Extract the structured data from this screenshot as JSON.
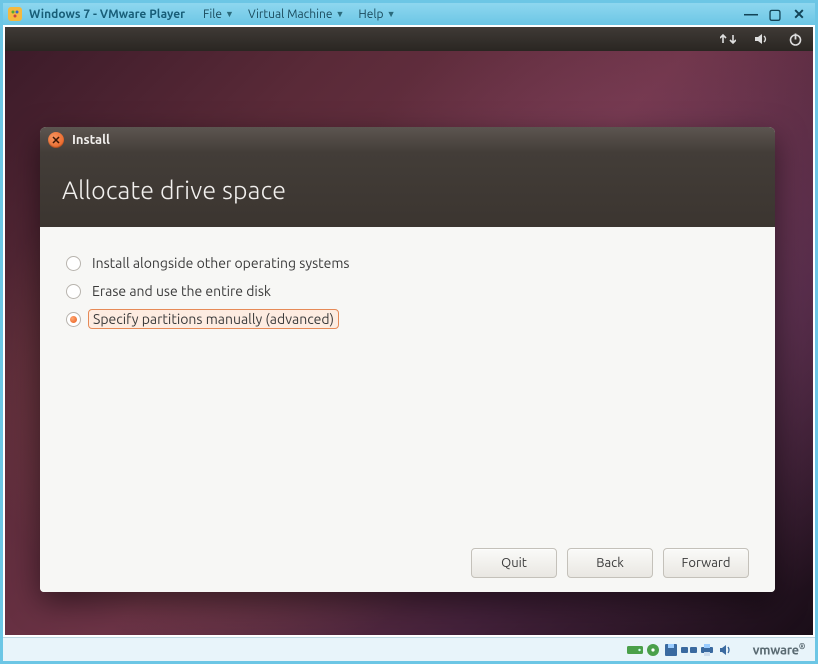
{
  "vmware": {
    "title": "Windows 7 - VMware Player",
    "menu": [
      "File",
      "Virtual Machine",
      "Help"
    ],
    "brand": "vmware"
  },
  "ubuntu_panel": {
    "icons": [
      "network-icon",
      "sound-icon",
      "power-icon"
    ]
  },
  "dialog": {
    "window_title": "Install",
    "heading": "Allocate drive space",
    "options": [
      {
        "label": "Install alongside other operating systems",
        "checked": false
      },
      {
        "label": "Erase and use the entire disk",
        "checked": false
      },
      {
        "label": "Specify partitions manually (advanced)",
        "checked": true
      }
    ],
    "buttons": {
      "quit": "Quit",
      "back": "Back",
      "forward": "Forward"
    }
  }
}
